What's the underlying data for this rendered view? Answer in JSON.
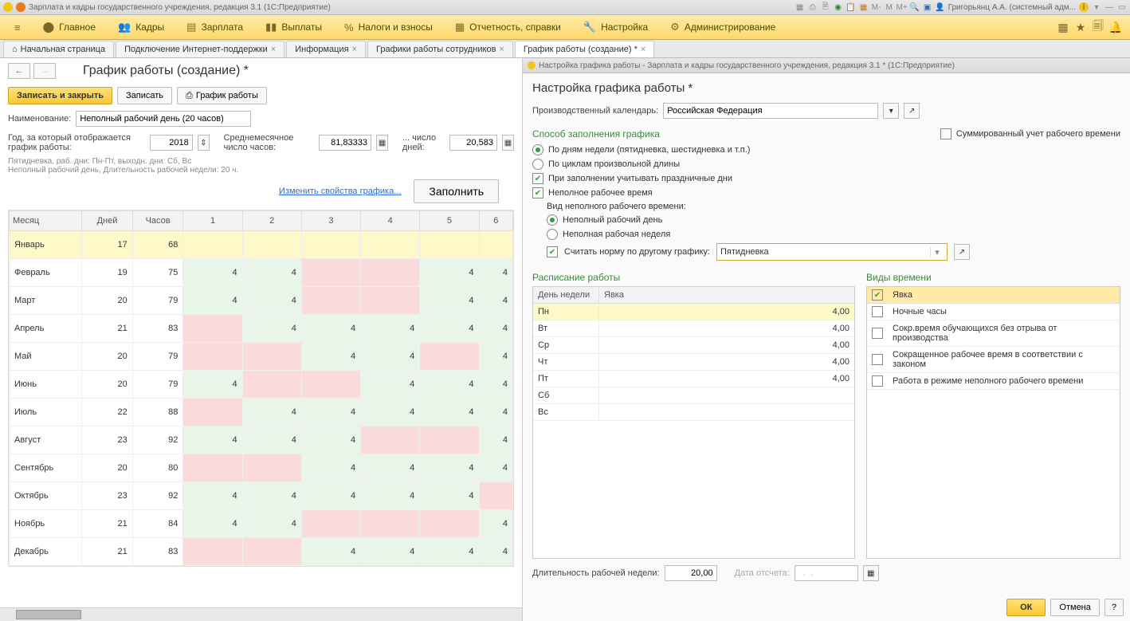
{
  "titlebar": {
    "app_title": "Зарплата и кадры государственного учреждения, редакция 3.1  (1С:Предприятие)",
    "user": "Григорьянц А.А. (системный адм...",
    "m_labels": [
      "M-",
      "M",
      "M+"
    ]
  },
  "menubar": {
    "items": [
      {
        "label": "Главное"
      },
      {
        "label": "Кадры"
      },
      {
        "label": "Зарплата"
      },
      {
        "label": "Выплаты"
      },
      {
        "label": "Налоги и взносы"
      },
      {
        "label": "Отчетность, справки"
      },
      {
        "label": "Настройка"
      },
      {
        "label": "Администрирование"
      }
    ]
  },
  "tabs": {
    "items": [
      {
        "label": "Начальная страница",
        "home": true,
        "closable": false
      },
      {
        "label": "Подключение Интернет-поддержки",
        "closable": true
      },
      {
        "label": "Информация",
        "closable": true
      },
      {
        "label": "Графики работы сотрудников",
        "closable": true
      },
      {
        "label": "График работы (создание) *",
        "closable": true,
        "active": true
      }
    ]
  },
  "left": {
    "title": "График работы (создание) *",
    "save_close": "Записать и закрыть",
    "save": "Записать",
    "print": "График работы",
    "name_lbl": "Наименование:",
    "name_val": "Неполный рабочий день (20 часов)",
    "year_lbl": "Год, за который отображается график работы:",
    "year_val": "2018",
    "avg_lbl": "Среднемесячное число часов:",
    "avg_val": "81,83333",
    "days_lbl": "... число дней:",
    "days_val": "20,583",
    "info1": "Пятидневка, раб. дни: Пн-Пт, выходн. дни: Сб, Вс",
    "info2": "Неполный рабочий день, Длительность рабочей недели: 20 ч.",
    "change_link": "Изменить свойства графика...",
    "fill_btn": "Заполнить",
    "cols": [
      "Месяц",
      "Дней",
      "Часов",
      "1",
      "2",
      "3",
      "4",
      "5",
      "6"
    ],
    "rows": [
      {
        "m": "Январь",
        "d": "17",
        "h": "68",
        "c": [
          "",
          "",
          "",
          "",
          "",
          ""
        ],
        "sel": true,
        "pat": [
          "",
          "",
          "",
          "",
          "",
          ""
        ]
      },
      {
        "m": "Февраль",
        "d": "19",
        "h": "75",
        "c": [
          "4",
          "4",
          "",
          "",
          "4",
          "4"
        ],
        "pat": [
          "g",
          "g",
          "p",
          "p",
          "g",
          "g"
        ]
      },
      {
        "m": "Март",
        "d": "20",
        "h": "79",
        "c": [
          "4",
          "4",
          "",
          "",
          "4",
          "4"
        ],
        "pat": [
          "g",
          "g",
          "p",
          "p",
          "g",
          "g"
        ]
      },
      {
        "m": "Апрель",
        "d": "21",
        "h": "83",
        "c": [
          "",
          "4",
          "4",
          "4",
          "4",
          "4"
        ],
        "pat": [
          "p",
          "g",
          "g",
          "g",
          "g",
          "g"
        ]
      },
      {
        "m": "Май",
        "d": "20",
        "h": "79",
        "c": [
          "",
          "",
          "4",
          "4",
          "",
          "4"
        ],
        "pat": [
          "p",
          "p",
          "g",
          "g",
          "p",
          "g"
        ]
      },
      {
        "m": "Июнь",
        "d": "20",
        "h": "79",
        "c": [
          "4",
          "",
          "",
          "4",
          "4",
          "4"
        ],
        "pat": [
          "g",
          "p",
          "p",
          "g",
          "g",
          "g"
        ]
      },
      {
        "m": "Июль",
        "d": "22",
        "h": "88",
        "c": [
          "",
          "4",
          "4",
          "4",
          "4",
          "4"
        ],
        "pat": [
          "p",
          "g",
          "g",
          "g",
          "g",
          "g"
        ]
      },
      {
        "m": "Август",
        "d": "23",
        "h": "92",
        "c": [
          "4",
          "4",
          "4",
          "",
          "",
          "4"
        ],
        "pat": [
          "g",
          "g",
          "g",
          "p",
          "p",
          "g"
        ]
      },
      {
        "m": "Сентябрь",
        "d": "20",
        "h": "80",
        "c": [
          "",
          "",
          "4",
          "4",
          "4",
          "4"
        ],
        "pat": [
          "p",
          "p",
          "g",
          "g",
          "g",
          "g"
        ]
      },
      {
        "m": "Октябрь",
        "d": "23",
        "h": "92",
        "c": [
          "4",
          "4",
          "4",
          "4",
          "4",
          ""
        ],
        "pat": [
          "g",
          "g",
          "g",
          "g",
          "g",
          "p"
        ]
      },
      {
        "m": "Ноябрь",
        "d": "21",
        "h": "84",
        "c": [
          "4",
          "4",
          "",
          "",
          "",
          "4"
        ],
        "pat": [
          "g",
          "g",
          "p",
          "p",
          "p",
          "g"
        ]
      },
      {
        "m": "Декабрь",
        "d": "21",
        "h": "83",
        "c": [
          "",
          "",
          "4",
          "4",
          "4",
          "4"
        ],
        "pat": [
          "p",
          "p",
          "g",
          "g",
          "g",
          "g"
        ]
      }
    ]
  },
  "right": {
    "wintitle": "Настройка графика работы - Зарплата и кадры государственного учреждения, редакция 3.1 *  (1С:Предприятие)",
    "title": "Настройка графика работы *",
    "calendar_lbl": "Производственный календарь:",
    "calendar_val": "Российская Федерация",
    "sect_fill": "Способ заполнения графика",
    "sum_chk": "Суммированный учет рабочего времени",
    "r1": "По дням недели (пятидневка, шестидневка и т.п.)",
    "r2": "По циклам произвольной длины",
    "c1": "При заполнении учитывать праздничные дни",
    "c2": "Неполное рабочее время",
    "sub_lbl": "Вид неполного рабочего времени:",
    "sr1": "Неполный рабочий день",
    "sr2": "Неполная рабочая неделя",
    "c3": "Считать норму по другому графику:",
    "norm_val": "Пятидневка",
    "sect_sched": "Расписание работы",
    "sect_types": "Виды времени",
    "sched_cols": [
      "День недели",
      "Явка"
    ],
    "sched_rows": [
      {
        "d": "Пн",
        "v": "4,00",
        "sel": true
      },
      {
        "d": "Вт",
        "v": "4,00"
      },
      {
        "d": "Ср",
        "v": "4,00"
      },
      {
        "d": "Чт",
        "v": "4,00"
      },
      {
        "d": "Пт",
        "v": "4,00"
      },
      {
        "d": "Сб",
        "v": ""
      },
      {
        "d": "Вс",
        "v": ""
      }
    ],
    "type_rows": [
      {
        "n": "Явка",
        "on": true,
        "sel": true
      },
      {
        "n": "Ночные часы"
      },
      {
        "n": "Сокр.время обучающихся без отрыва от производства"
      },
      {
        "n": "Сокращенное рабочее время в соответствии с законом"
      },
      {
        "n": "Работа в режиме неполного рабочего времени"
      }
    ],
    "dur_lbl": "Длительность рабочей недели:",
    "dur_val": "20,00",
    "date_lbl": "Дата отсчета:",
    "date_val": "  .  .    ",
    "ok": "ОК",
    "cancel": "Отмена",
    "help": "?"
  }
}
